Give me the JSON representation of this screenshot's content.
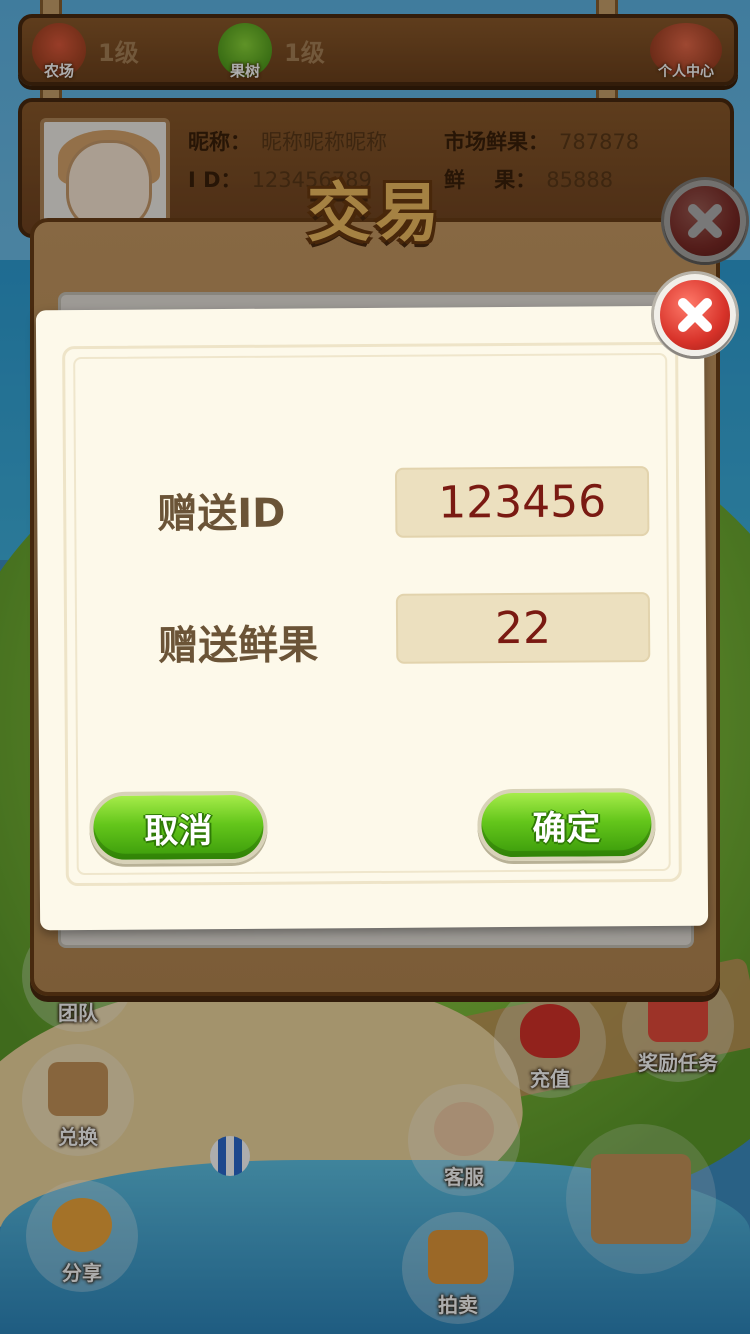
{
  "top_bar": {
    "farm": {
      "caption": "农场",
      "level": "1级"
    },
    "orchard": {
      "caption": "果树",
      "level": "1级"
    },
    "personal_center": {
      "caption": "个人中心"
    }
  },
  "profile": {
    "nickname_key": "昵称：",
    "nickname_value": "昵称昵称昵称",
    "id_key": "I D：",
    "id_value": "123456789",
    "market_fruit_key": "市场鲜果：",
    "market_fruit_value": "787878",
    "fruit_key": "鲜    果：",
    "fruit_value": "85888"
  },
  "trade_window": {
    "title": "交易"
  },
  "dialog": {
    "gift_id_label": "赠送ID",
    "gift_id_value": "123456",
    "gift_fruit_label": "赠送鲜果",
    "gift_fruit_value": "22",
    "cancel_label": "取消",
    "confirm_label": "确定"
  },
  "bottom_menu": {
    "team": "团队",
    "recharge": "充值",
    "reward_task": "奖励任务",
    "exchange": "兑换",
    "customer_service": "客服",
    "share": "分享",
    "auction": "拍卖"
  },
  "colors": {
    "wood": "#8c5a2b",
    "dialog_bg": "#fdf9ea",
    "field_bg": "#ece0bf",
    "value_text": "#7a1a12",
    "label_text": "#6b5437",
    "button_green": "#64c61b",
    "close_red": "#d8332a"
  },
  "icons": {
    "close": "close-icon",
    "farm": "farm-house-icon",
    "orchard": "fruit-tree-icon",
    "personal_center": "house-icon"
  }
}
